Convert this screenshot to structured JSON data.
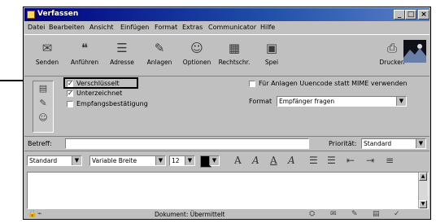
{
  "window": {
    "title": "Verfassen"
  },
  "titlebar_buttons": {
    "minimize": "_",
    "maximize": "□",
    "close": "×"
  },
  "menu": [
    {
      "label": "Datei"
    },
    {
      "label": "Bearbeiten"
    },
    {
      "label": "Ansicht"
    },
    {
      "label": "Einfügen"
    },
    {
      "label": "Format"
    },
    {
      "label": "Extras"
    },
    {
      "label": "Communicator"
    },
    {
      "label": "Hilfe"
    }
  ],
  "toolbar": {
    "items": [
      {
        "label": "Senden",
        "icon": "send-icon"
      },
      {
        "label": "Anführen",
        "icon": "quote-icon"
      },
      {
        "label": "Adresse",
        "icon": "address-icon"
      },
      {
        "label": "Anlagen",
        "icon": "attach-icon"
      },
      {
        "label": "Optionen",
        "icon": "options-icon"
      },
      {
        "label": "Rechtschr.",
        "icon": "spelling-icon"
      },
      {
        "label": "Spei",
        "icon": "save-icon"
      },
      {
        "label": "Drucken",
        "icon": "print-icon"
      }
    ]
  },
  "options": {
    "verschluesselt": {
      "label": "Verschlüsselt",
      "checked": true
    },
    "unterzeichnet": {
      "label": "Unterzeichnet",
      "checked": true
    },
    "empfang": {
      "label": "Empfangsbestätigung",
      "checked": false
    },
    "uuencode": {
      "label": "Für Anlagen Uuencode statt MIME verwenden",
      "checked": false
    },
    "format_label": "Format",
    "format_value": "Empfänger fragen"
  },
  "subject": {
    "label": "Betreff:",
    "value": "",
    "priority_label": "Priorität:",
    "priority_value": "Standard"
  },
  "format_bar": {
    "style": "Standard",
    "font": "Variable Breite",
    "size": "12"
  },
  "status": {
    "text": "Dokument: Übermittelt"
  }
}
